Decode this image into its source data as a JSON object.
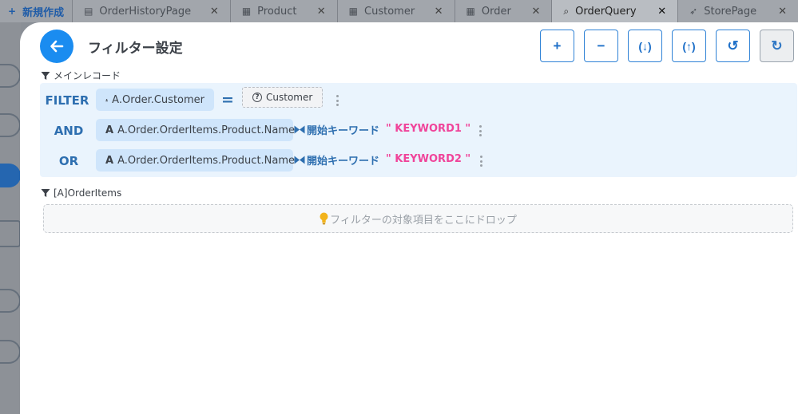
{
  "tabs": [
    {
      "label": "新規作成",
      "icon": "plus-icon",
      "first": true,
      "closable": false
    },
    {
      "label": "OrderHistoryPage",
      "icon": "table-icon",
      "closable": true
    },
    {
      "label": "Product",
      "icon": "grid-icon",
      "closable": true
    },
    {
      "label": "Customer",
      "icon": "grid-icon",
      "closable": true
    },
    {
      "label": "Order",
      "icon": "grid-icon",
      "closable": true
    },
    {
      "label": "OrderQuery",
      "icon": "search-icon",
      "active": true,
      "closable": true
    },
    {
      "label": "StorePage",
      "icon": "rocket-icon",
      "closable": true
    }
  ],
  "modal": {
    "title": "フィルター設定",
    "toolbar": {
      "add": "+",
      "remove": "−",
      "group_down": "(↓)",
      "group_up": "(↑)",
      "undo": "↺",
      "redo": "↻"
    }
  },
  "main_record": {
    "label": "メインレコード",
    "rows": [
      {
        "operator": "FILTER",
        "field": "A.Order.Customer",
        "field_icon": "person-icon",
        "comparator": "=",
        "value": "Customer",
        "value_icon": "question-circle-icon"
      },
      {
        "operator": "AND",
        "field": "A.Order.OrderItems.Product.Name",
        "field_icon": "text-a-icon",
        "comparator_text": "開始キーワード",
        "value": "\" KEYWORD1 \""
      },
      {
        "operator": "OR",
        "field": "A.Order.OrderItems.Product.Name",
        "field_icon": "text-a-icon",
        "comparator_text": "開始キーワード",
        "value": "\" KEYWORD2 \""
      }
    ]
  },
  "order_items": {
    "label": "[A]OrderItems",
    "drop_hint": "フィルターの対象項目をここにドロップ"
  },
  "colors": {
    "accent": "#1a8cf0",
    "operator": "#2e6fb0",
    "keyword": "#f0449a",
    "chip": "#cfe5fb",
    "box": "#eaf4fd"
  }
}
